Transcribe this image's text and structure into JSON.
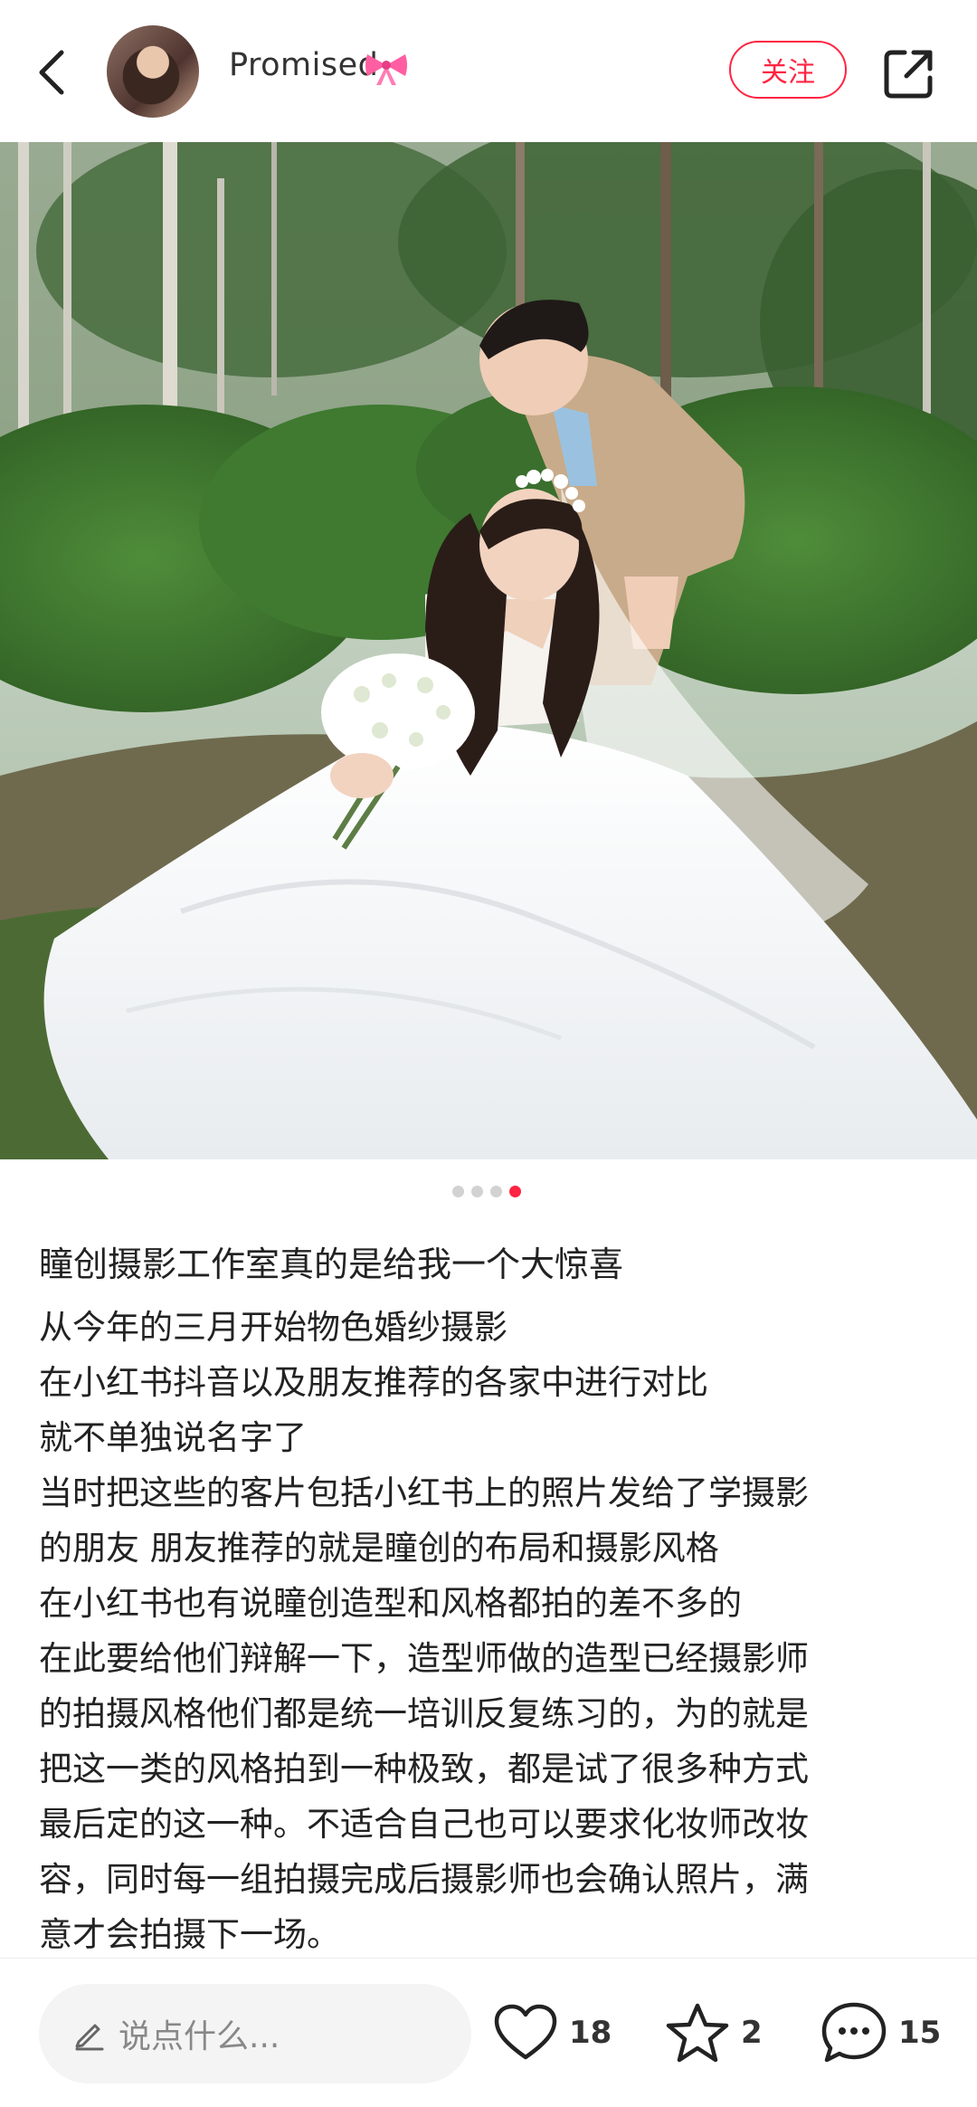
{
  "header": {
    "author_name": "Promised",
    "follow_label": "关注",
    "icons": {
      "back": "back-chevron-icon",
      "share": "share-icon",
      "bow": "pink-bow-emoji"
    }
  },
  "carousel": {
    "total": 4,
    "active_index": 3
  },
  "post": {
    "title": "瞳创摄影工作室真的是给我一个大惊喜",
    "lines": [
      "从今年的三月开始物色婚纱摄影",
      "在小红书抖音以及朋友推荐的各家中进行对比",
      "就不单独说名字了",
      "当时把这些的客片包括小红书上的照片发给了学摄影",
      "的朋友 朋友推荐的就是瞳创的布局和摄影风格",
      "在小红书也有说瞳创造型和风格都拍的差不多的",
      "在此要给他们辩解一下，造型师做的造型已经摄影师",
      "的拍摄风格他们都是统一培训反复练习的，为的就是",
      "把这一类的风格拍到一种极致，都是试了很多种方式",
      "最后定的这一种。不适合自己也可以要求化妆师改妆",
      "容，同时每一组拍摄完成后摄影师也会确认照片，满",
      "意才会拍摄下一场。"
    ]
  },
  "bottom_bar": {
    "comment_placeholder": "说点什么...",
    "likes": "18",
    "favorites": "2",
    "comments": "15"
  },
  "colors": {
    "accent": "#ff2442",
    "text": "#222222",
    "muted": "#888888"
  }
}
